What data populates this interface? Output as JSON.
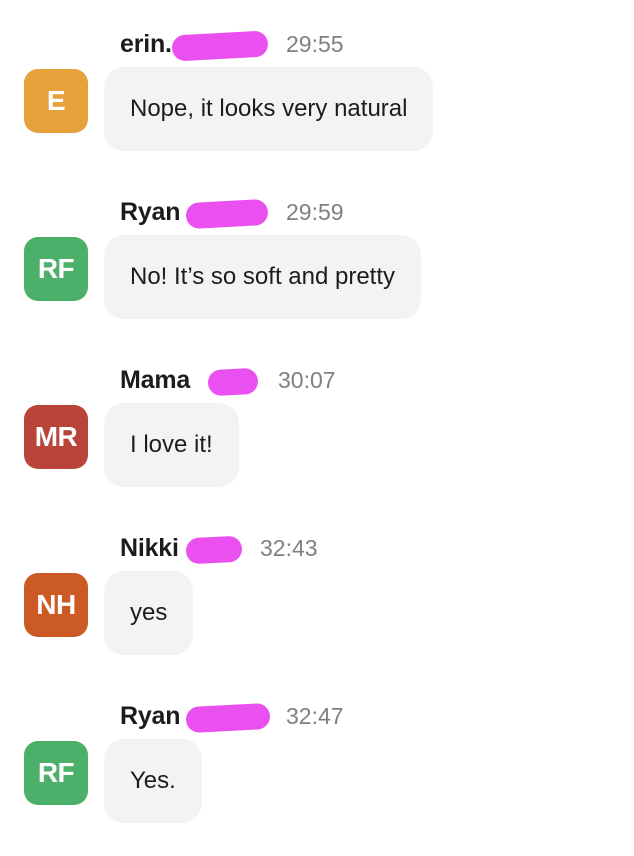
{
  "messages": [
    {
      "sender": "erin.",
      "time": "29:55",
      "initials": "E",
      "avatar_color": "#e8a23c",
      "text": "Nope, it looks very natural"
    },
    {
      "sender": "Ryan",
      "time": "29:59",
      "initials": "RF",
      "avatar_color": "#4caf6a",
      "text": "No! It’s so soft and pretty"
    },
    {
      "sender": "Mama",
      "time": "30:07",
      "initials": "MR",
      "avatar_color": "#b9443a",
      "text": "I love it!"
    },
    {
      "sender": "Nikki",
      "time": "32:43",
      "initials": "NH",
      "avatar_color": "#cc5a24",
      "text": "yes"
    },
    {
      "sender": "Ryan",
      "time": "32:47",
      "initials": "RF",
      "avatar_color": "#4caf6a",
      "text": "Yes."
    }
  ]
}
